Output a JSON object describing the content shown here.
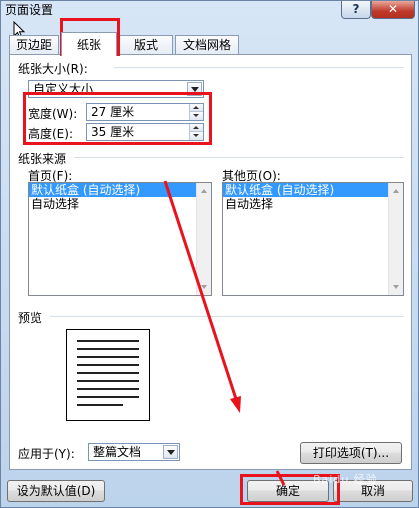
{
  "window": {
    "title": "页面设置",
    "help_label": "?",
    "close_label": "✕"
  },
  "tabs": [
    {
      "label": "页边距"
    },
    {
      "label": "纸张",
      "active": true
    },
    {
      "label": "版式"
    },
    {
      "label": "文档网格"
    }
  ],
  "paper_size": {
    "group_label": "纸张大小(R):",
    "selected": "自定义大小",
    "width_label": "宽度(W):",
    "width_value": "27 厘米",
    "height_label": "高度(E):",
    "height_value": "35 厘米"
  },
  "paper_source": {
    "group_label": "纸张来源",
    "first_page_label": "首页(F):",
    "other_pages_label": "其他页(O):",
    "first_page_items": [
      "默认纸盒 (自动选择)",
      "自动选择"
    ],
    "other_pages_items": [
      "默认纸盒 (自动选择)",
      "自动选择"
    ]
  },
  "preview": {
    "group_label": "预览"
  },
  "apply_to": {
    "label": "应用于(Y):",
    "selected": "整篇文档"
  },
  "buttons": {
    "print_options": "打印选项(T)...",
    "set_default": "设为默认值(D)",
    "ok": "确定",
    "cancel": "取消"
  },
  "watermark": "Baidu 经验",
  "colors": {
    "annotation_red": "#e8131c",
    "selection_blue": "#3399ff",
    "window_frame": "#bcd3ec"
  }
}
